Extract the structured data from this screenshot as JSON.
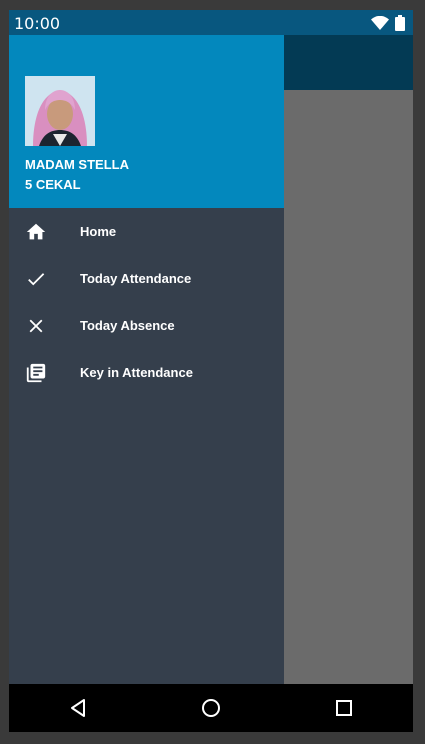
{
  "status_bar": {
    "time": "10:00",
    "icons": [
      "wifi-icon",
      "battery-icon"
    ]
  },
  "drawer": {
    "header": {
      "name": "MADAM STELLA",
      "class_label": "5 CEKAL",
      "avatar": "avatar-photo"
    },
    "items": [
      {
        "label": "Home",
        "icon": "home-icon"
      },
      {
        "label": "Today Attendance",
        "icon": "check-icon"
      },
      {
        "label": "Today Absence",
        "icon": "close-icon"
      },
      {
        "label": "Key in Attendance",
        "icon": "library-books-icon"
      }
    ]
  },
  "nav_bar": {
    "buttons": [
      "back-icon",
      "home-circle-icon",
      "recents-icon"
    ]
  },
  "colors": {
    "status_bar": "#08577f",
    "drawer_header": "#0388bd",
    "drawer_body": "#353f4c",
    "app_bar": "#033a54",
    "scrim": "#6b6b6b"
  }
}
